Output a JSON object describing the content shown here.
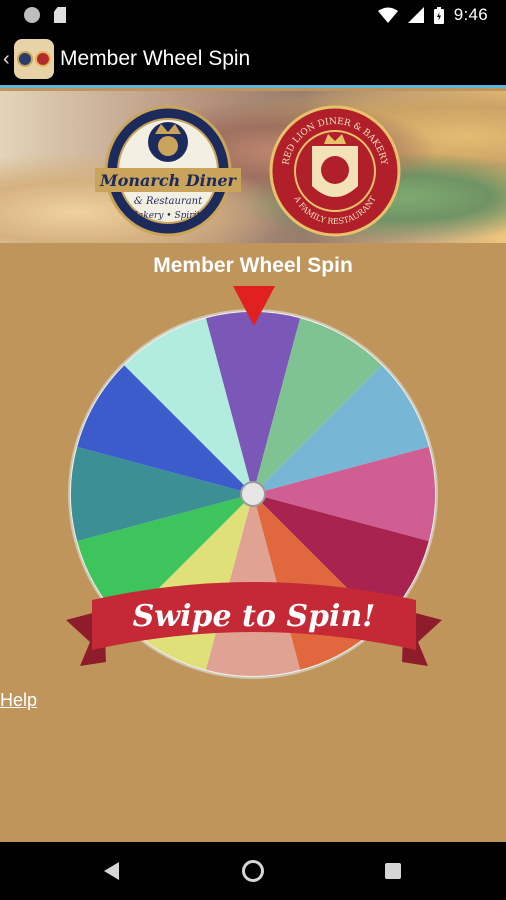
{
  "status_bar": {
    "time": "9:46"
  },
  "toolbar": {
    "title": "Member Wheel Spin"
  },
  "banner": {
    "logo_left": {
      "name": "Monarch Diner",
      "sub": "& Restaurant",
      "tag": "Bakery • Spirits"
    },
    "logo_right": {
      "ring_top": "RED LION DINER & BAKERY",
      "ring_bottom": "A FAMILY RESTAURANT"
    }
  },
  "wheel": {
    "heading": "Member Wheel Spin",
    "segment_colors": [
      "#7b58b8",
      "#7fc393",
      "#78b6d6",
      "#d05e92",
      "#a8234f",
      "#e0673e",
      "#e0a293",
      "#e0e07a",
      "#3ec45c",
      "#3b8f95",
      "#3d5ccc",
      "#b2ecdf"
    ],
    "cta": "Swipe to Spin!"
  },
  "help": {
    "label": "Help"
  }
}
